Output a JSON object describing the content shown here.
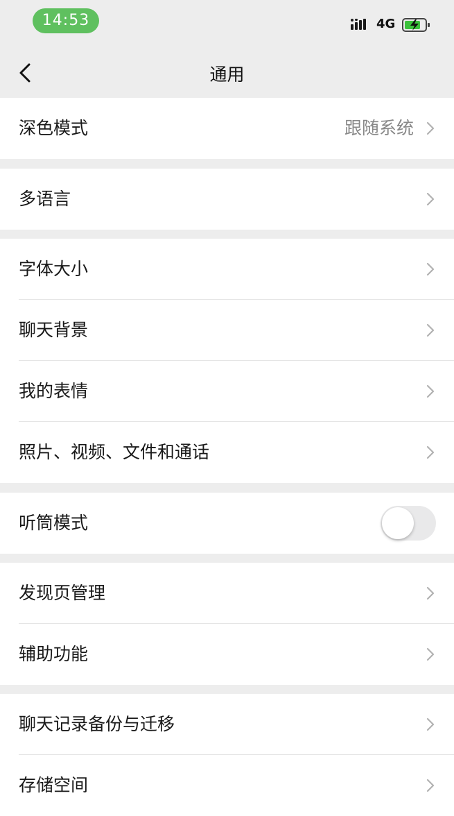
{
  "status_bar": {
    "time": "14:53",
    "network": "4G"
  },
  "nav": {
    "title": "通用"
  },
  "groups": [
    {
      "items": [
        {
          "label": "深色模式",
          "value": "跟随系统"
        }
      ]
    },
    {
      "items": [
        {
          "label": "多语言"
        }
      ]
    },
    {
      "items": [
        {
          "label": "字体大小"
        },
        {
          "label": "聊天背景"
        },
        {
          "label": "我的表情"
        },
        {
          "label": "照片、视频、文件和通话"
        }
      ]
    },
    {
      "items": [
        {
          "label": "听筒模式",
          "toggle": false
        }
      ]
    },
    {
      "items": [
        {
          "label": "发现页管理"
        },
        {
          "label": "辅助功能"
        }
      ]
    },
    {
      "items": [
        {
          "label": "聊天记录备份与迁移"
        },
        {
          "label": "存储空间"
        }
      ]
    }
  ],
  "colors": {
    "status_pill": "#5fc05f",
    "background": "#ededed",
    "cell": "#ffffff"
  }
}
